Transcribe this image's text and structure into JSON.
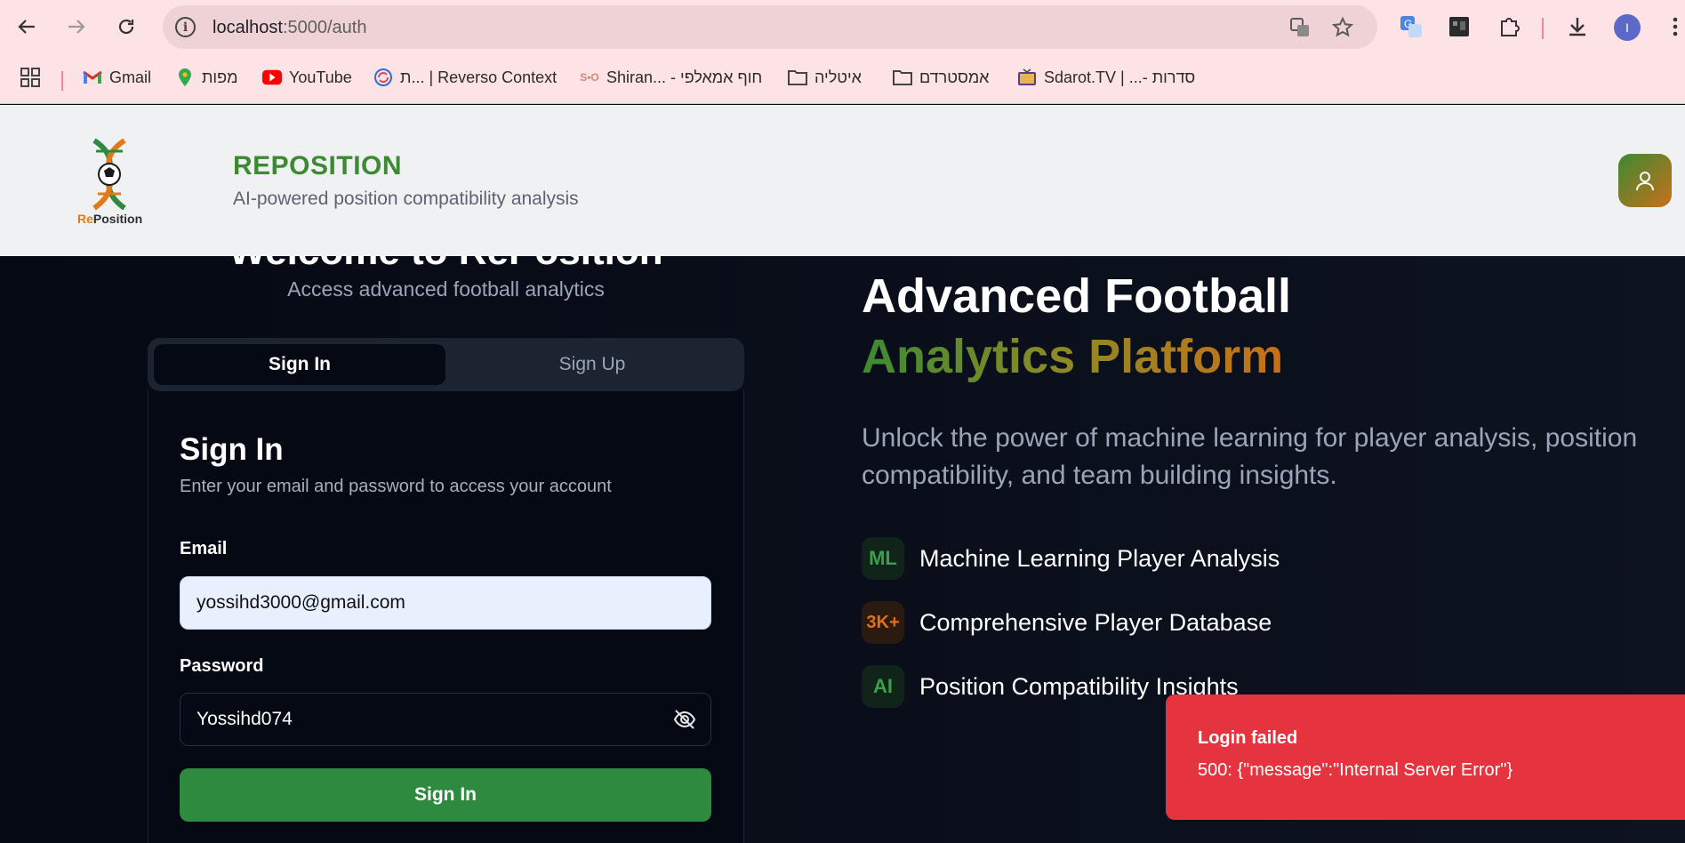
{
  "browser": {
    "url_host": "localhost",
    "url_path": ":5000/auth",
    "profile_initial": "I",
    "bookmarks": [
      {
        "label": "Gmail",
        "icon": "gmail-icon"
      },
      {
        "label": "מפות",
        "icon": "maps-icon"
      },
      {
        "label": "YouTube",
        "icon": "youtube-icon"
      },
      {
        "label": "ת... | Reverso Context",
        "icon": "reverso-icon"
      },
      {
        "label": "Shiran... - חוף אמאלפי",
        "icon": "shiran-icon"
      },
      {
        "label": "איטליה",
        "icon": "folder-icon"
      },
      {
        "label": "אמסטרדם",
        "icon": "folder-icon"
      },
      {
        "label": "Sdarot.TV | ...- סדרות",
        "icon": "tv-icon"
      }
    ]
  },
  "header": {
    "logo_text_re": "Re",
    "logo_text_rest": "Position",
    "title": "REPOSITION",
    "subtitle": "AI-powered position compatibility analysis"
  },
  "auth": {
    "welcome": "Welcome to RePosition",
    "welcome_sub": "Access advanced football analytics",
    "tabs": {
      "signin": "Sign In",
      "signup": "Sign Up"
    },
    "card_title": "Sign In",
    "card_desc": "Enter your email and password to access your account",
    "email_label": "Email",
    "email_value": "yossihd3000@gmail.com",
    "password_label": "Password",
    "password_value": "Yossihd074",
    "submit_label": "Sign In"
  },
  "hero": {
    "line1": "Advanced Football",
    "line2": "Analytics Platform",
    "description": "Unlock the power of machine learning for player analysis, position compatibility, and team building insights.",
    "features": [
      {
        "badge": "ML",
        "text": "Machine Learning Player Analysis",
        "color": "#3aa04a"
      },
      {
        "badge": "3K+",
        "text": "Comprehensive Player Database",
        "color": "#e0701a"
      },
      {
        "badge": "AI",
        "text": "Position Compatibility Insights",
        "color": "#3aa04a"
      }
    ]
  },
  "toast": {
    "title": "Login failed",
    "message": "500: {\"message\":\"Internal Server Error\"}",
    "color": "#e5343f"
  }
}
